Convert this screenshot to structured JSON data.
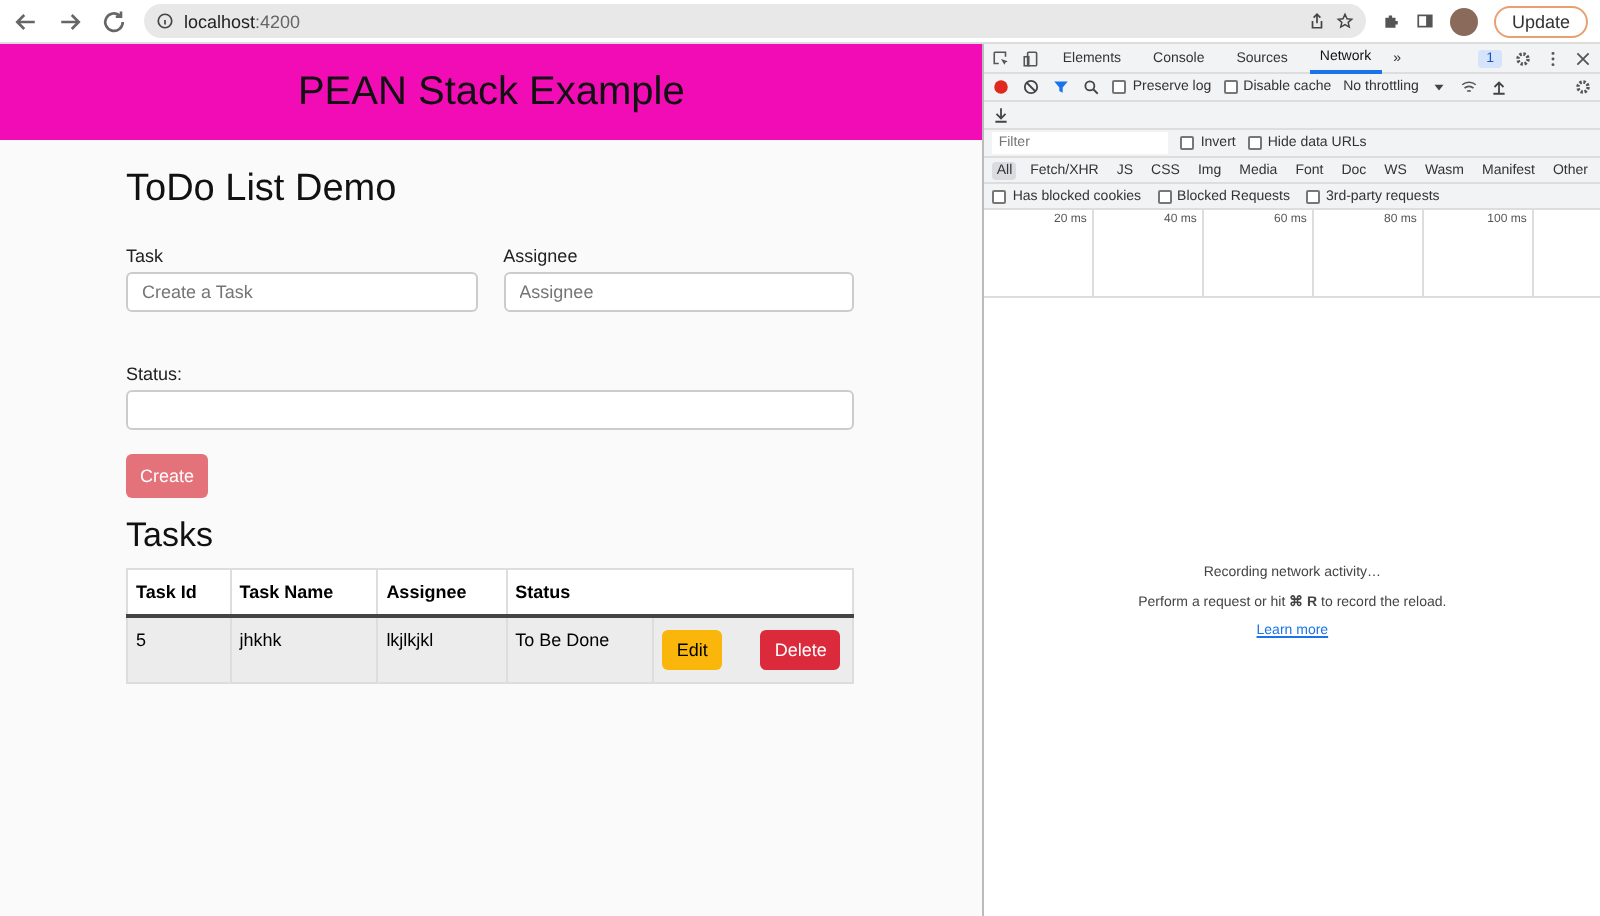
{
  "browser": {
    "url_host": "localhost",
    "url_port": ":4200",
    "update_button": "Update"
  },
  "page": {
    "header_title": "PEAN Stack Example",
    "heading": "ToDo List Demo",
    "fields": [
      {
        "label": "Task",
        "placeholder": "Create a Task",
        "kind": "half"
      },
      {
        "label": "Assignee",
        "placeholder": "Assignee",
        "kind": "half"
      },
      {
        "label": "Status:",
        "kind": "full"
      }
    ],
    "create_button": "Create",
    "tasks_heading": "Tasks",
    "table": {
      "columns": [
        "Task Id",
        "Task Name",
        "Assignee",
        "Status"
      ],
      "rows": [
        {
          "cells": [
            "5",
            "jhkhk",
            "lkjlkjkl",
            "To Be Done"
          ],
          "edit": "Edit",
          "delete": "Delete"
        }
      ]
    }
  },
  "devtools": {
    "tabs": [
      {
        "label": "Elements",
        "selected": false
      },
      {
        "label": "Console",
        "selected": false
      },
      {
        "label": "Sources",
        "selected": false
      },
      {
        "label": "Network",
        "selected": true
      }
    ],
    "more_tabs": "»",
    "issues_count": "1",
    "toolbar_checks": [
      {
        "label": "Preserve log",
        "checked": false
      },
      {
        "label": "Disable cache",
        "checked": false
      }
    ],
    "throttling": "No throttling",
    "filter_placeholder": "Filter",
    "filter_checks": [
      {
        "label": "Invert",
        "checked": false
      },
      {
        "label": "Hide data URLs",
        "checked": false
      }
    ],
    "types": [
      {
        "label": "All",
        "selected": true
      },
      {
        "label": "Fetch/XHR",
        "selected": false
      },
      {
        "label": "JS",
        "selected": false
      },
      {
        "label": "CSS",
        "selected": false
      },
      {
        "label": "Img",
        "selected": false
      },
      {
        "label": "Media",
        "selected": false
      },
      {
        "label": "Font",
        "selected": false
      },
      {
        "label": "Doc",
        "selected": false
      },
      {
        "label": "WS",
        "selected": false
      },
      {
        "label": "Wasm",
        "selected": false
      },
      {
        "label": "Manifest",
        "selected": false
      },
      {
        "label": "Other",
        "selected": false
      }
    ],
    "block_checks": [
      {
        "label": "Has blocked cookies",
        "checked": false
      },
      {
        "label": "Blocked Requests",
        "checked": false
      },
      {
        "label": "3rd-party requests",
        "checked": false
      }
    ],
    "ticks": [
      "20 ms",
      "40 ms",
      "60 ms",
      "80 ms",
      "100 ms"
    ],
    "empty_title": "Recording network activity…",
    "empty_message": "Perform a request or hit **⌘ R** to record the reload.",
    "learn_more": "Learn more"
  }
}
